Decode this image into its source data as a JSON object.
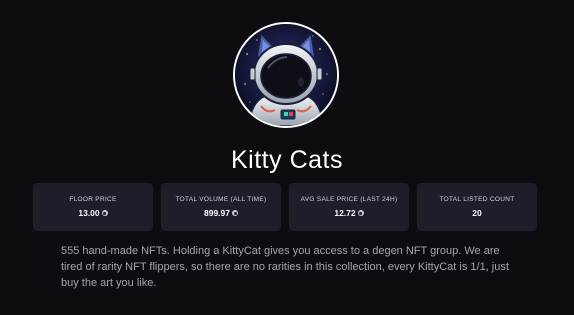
{
  "collection": {
    "name": "Kitty Cats",
    "avatar_alt": "astronaut-cat-avatar"
  },
  "stats": [
    {
      "label": "FLOOR PRICE",
      "value": "13.00",
      "icon": "sol-coin-icon"
    },
    {
      "label": "TOTAL VOLUME (ALL TIME)",
      "value": "899.97",
      "icon": "sol-coin-icon"
    },
    {
      "label": "AVG SALE PRICE (LAST 24H)",
      "value": "12.72",
      "icon": "sol-coin-icon"
    },
    {
      "label": "TOTAL LISTED COUNT",
      "value": "20",
      "icon": ""
    }
  ],
  "description": "555 hand-made NFTs. Holding a KittyCat gives you access to a degen NFT group. We are tired of rarity NFT flippers, so there are no rarities in this collection, every KittyCat is 1/1, just buy the art you like.",
  "colors": {
    "background": "#0d0c11",
    "card": "#1e1d29",
    "text_primary": "#ffffff",
    "text_secondary": "#a6a5ad"
  }
}
